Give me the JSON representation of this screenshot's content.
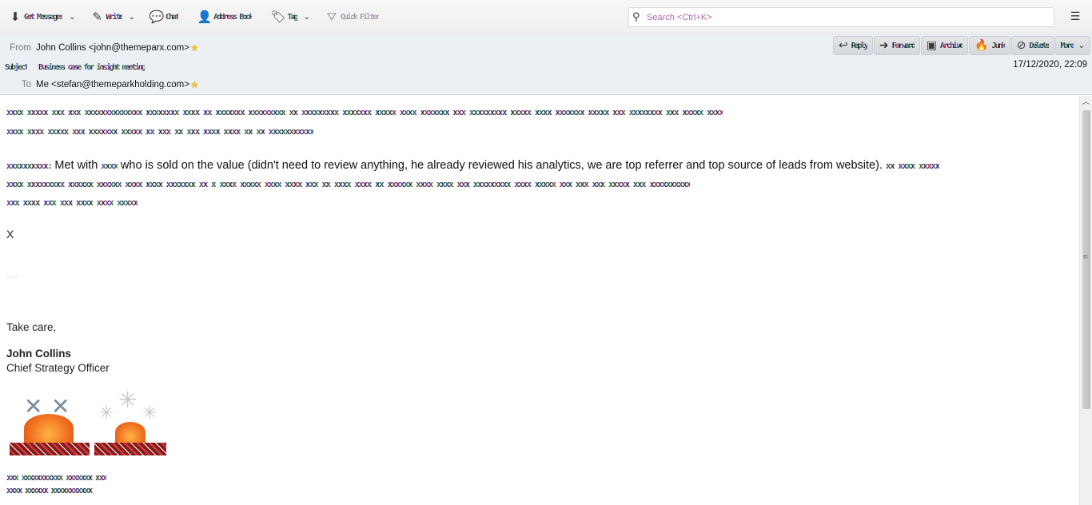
{
  "toolbar": {
    "buttons": [
      {
        "label": "Get Messages",
        "icon": "get-messages-icon",
        "glyph": "⬇",
        "has_menu": true
      },
      {
        "label": "Write",
        "icon": "write-icon",
        "glyph": "✎",
        "has_menu": true
      },
      {
        "label": "Chat",
        "icon": "chat-icon",
        "glyph": "💬",
        "has_menu": false
      },
      {
        "label": "Address Book",
        "icon": "address-book-icon",
        "glyph": "👤",
        "has_menu": false
      },
      {
        "label": "Tag",
        "icon": "tag-icon",
        "glyph": "🏷",
        "has_menu": true
      },
      {
        "label": "Quick Filter",
        "icon": "filter-icon",
        "glyph": "⛛",
        "has_menu": false,
        "disabled": true
      }
    ],
    "search_placeholder": "Search <Ctrl+K>",
    "menu_icon": "☰"
  },
  "header": {
    "from_label": "From",
    "from_value": "John Collins <john@themeparx.com>",
    "subject_label": "Subject",
    "subject_value": "Business case for insight meeting",
    "to_label": "To",
    "to_value": "Me <stefan@themeparkholding.com>",
    "date": "17/12/2020, 22:09",
    "actions": [
      {
        "label": "Reply",
        "glyph": "↩"
      },
      {
        "label": "Forward",
        "glyph": "➜"
      },
      {
        "label": "Archive",
        "glyph": "▣"
      },
      {
        "label": "Junk",
        "glyph": "🔥"
      },
      {
        "label": "Delete",
        "glyph": "⊘"
      },
      {
        "label": "More",
        "glyph": "",
        "has_menu": true
      }
    ]
  },
  "message": {
    "para1_scrambled_a": "xxxx xxxxx xxx xxx xxxxxxxxxxxxxx xxxxxxxx xxxx xx xxxxxxx xxxxxxxxx xx xxxxxxxxx xxxxxxx xxxxx xxxx xxxxxxx xxx xxxxxxxxx  xxxxx xxxx xxxxxxx xxxxx xxx xxxxxxxx xxx  xxxxx xxxx",
    "para1_scrambled_b": "xxxx xxxx xxxxx xxx xxxxxxx xxxxx xx xxx xx xxx xxxx xxxx xx xx xxxxxxxxxxx",
    "para2_prefix": "xxxxxxxxxx:",
    "para2_text_a": " Met with ",
    "para2_name": "xxxx",
    "para2_text_b": " who is sold on the value (didn't need to review anything, he already reviewed his analytics, we are top referrer and top source of leads from website). ",
    "para2_suffix": "xx xxxx xxxxx",
    "para2_scrambled_b": "xxxx xxxxxxxxx xxxxxx xxxxxx xxxx xxxx xxxxxxx xx x xxxx xxxxx xxxx xxxx xxx xx xxxx xxxx xx xxxxxx xxxx xxxx xxx  xxxxxxxxx xxxx xxxxx xxx xxx xxx xxxxx xxx xxxxxxxxxx",
    "para2_scrambled_c": "xxx xxxx xxx xxx  xxxx xxxx xxxxx",
    "x_line": "X",
    "faint_line": "xxx",
    "signoff": "Take care,",
    "sig_name": "John Collins",
    "sig_title": "Chief Strategy Officer",
    "footer_line1": "xxx xxxxxxxxxxx xxxxxxx xxx",
    "footer_line2": "xxxx xxxxxx xxxxxxxxxxx"
  }
}
